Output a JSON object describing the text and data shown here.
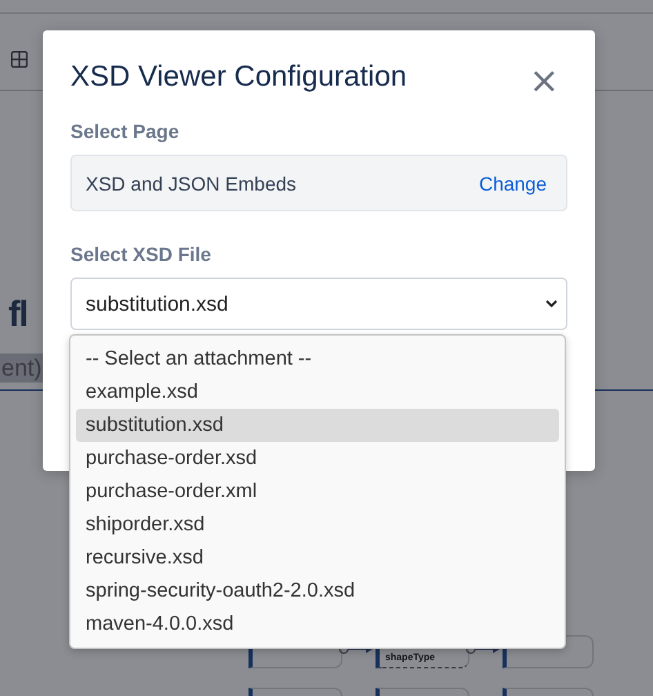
{
  "background": {
    "heading": "fl",
    "highlighted_text": "ent)",
    "diagram_label": "shapeType"
  },
  "dialog": {
    "title": "XSD Viewer Configuration",
    "close": "×",
    "page_section": {
      "label": "Select Page",
      "value": "XSD and JSON Embeds",
      "action": "Change"
    },
    "file_section": {
      "label": "Select XSD File",
      "value": "substitution.xsd"
    },
    "options": [
      {
        "label": "-- Select an attachment --",
        "selected": false
      },
      {
        "label": "example.xsd",
        "selected": false
      },
      {
        "label": "substitution.xsd",
        "selected": true
      },
      {
        "label": "purchase-order.xsd",
        "selected": false
      },
      {
        "label": "purchase-order.xml",
        "selected": false
      },
      {
        "label": "shiporder.xsd",
        "selected": false
      },
      {
        "label": "recursive.xsd",
        "selected": false
      },
      {
        "label": "spring-security-oauth2-2.0.xsd",
        "selected": false
      },
      {
        "label": "maven-4.0.0.xsd",
        "selected": false
      }
    ]
  }
}
